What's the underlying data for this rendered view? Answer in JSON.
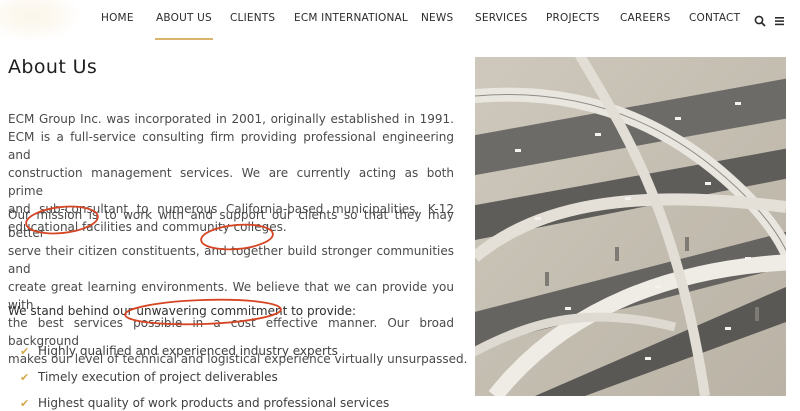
{
  "nav": {
    "items": [
      "HOME",
      "ABOUT US",
      "CLIENTS",
      "ECM INTERNATIONAL",
      "NEWS",
      "SERVICES",
      "PROJECTS",
      "CAREERS",
      "CONTACT"
    ],
    "active": "ABOUT US",
    "search_icon": "search-icon",
    "menu_icon": "hamburger-menu-icon"
  },
  "page": {
    "title": "About Us"
  },
  "paragraphs": {
    "intro_lines": [
      "ECM Group Inc. was incorporated in 2001, originally established in 1991.",
      " ECM is a full-service consulting firm providing professional engineering and",
      "construction management services. We are currently acting as both prime",
      "and sub-consultant to numerous California-based municipalities, K-12",
      "educational facilities and community colleges."
    ],
    "mission_lines": [
      "Our mission is to work with and support our clients so that they may better",
      "serve their citizen constituents, and together build stronger communities and",
      "create great learning environments. We believe that we can provide you with",
      "the best services possible in a cost effective manner. Our broad background",
      "makes our level of technical and logistical experience virtually unsurpassed."
    ],
    "lead": "We stand behind our unwavering commitment to provide:"
  },
  "checklist": [
    "Highly qualified and experienced industry experts",
    "Timely execution of project deliverables",
    "Highest quality of work products and professional services"
  ],
  "colors": {
    "accent": "#d9b26b",
    "check": "#d6a84a",
    "annotation": "#d64524"
  },
  "images": {
    "hero": "aerial-freeway-interchange-photo"
  }
}
